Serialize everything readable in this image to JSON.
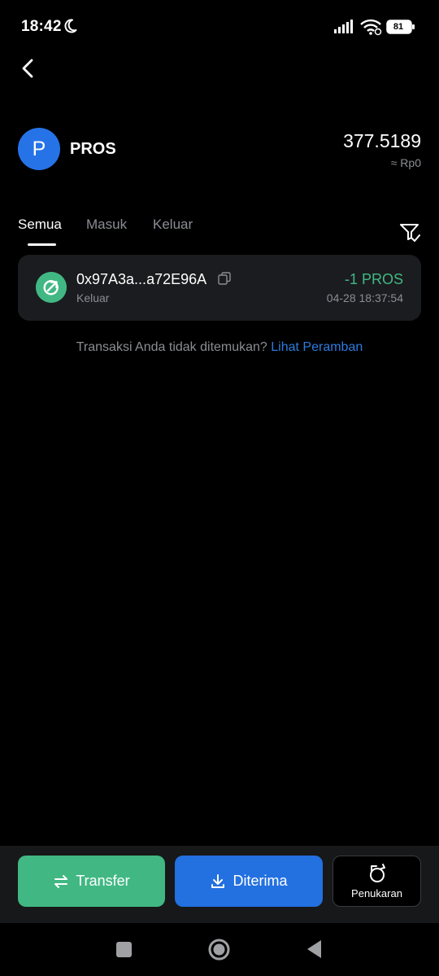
{
  "status_bar": {
    "time": "18:42",
    "battery": "81"
  },
  "token": {
    "avatar_letter": "P",
    "symbol": "PROS",
    "balance": "377.5189",
    "fiat_value": "≈ Rp0"
  },
  "tabs": [
    {
      "label": "Semua",
      "active": true
    },
    {
      "label": "Masuk",
      "active": false
    },
    {
      "label": "Keluar",
      "active": false
    }
  ],
  "transactions": [
    {
      "address": "0x97A3a...a72E96A",
      "type": "Keluar",
      "amount": "-1 PROS",
      "time": "04-28 18:37:54",
      "status_icon": "outgoing-icon"
    }
  ],
  "not_found": {
    "text": "Transaksi Anda tidak ditemukan?",
    "link": "Lihat Peramban"
  },
  "actions": {
    "transfer": "Transfer",
    "receive": "Diterima",
    "swap": "Penukaran"
  },
  "colors": {
    "background": "#000000",
    "accent_green": "#41b883",
    "accent_blue": "#2370e0",
    "card": "#1b1c1f",
    "muted_text": "#8a8d93"
  }
}
